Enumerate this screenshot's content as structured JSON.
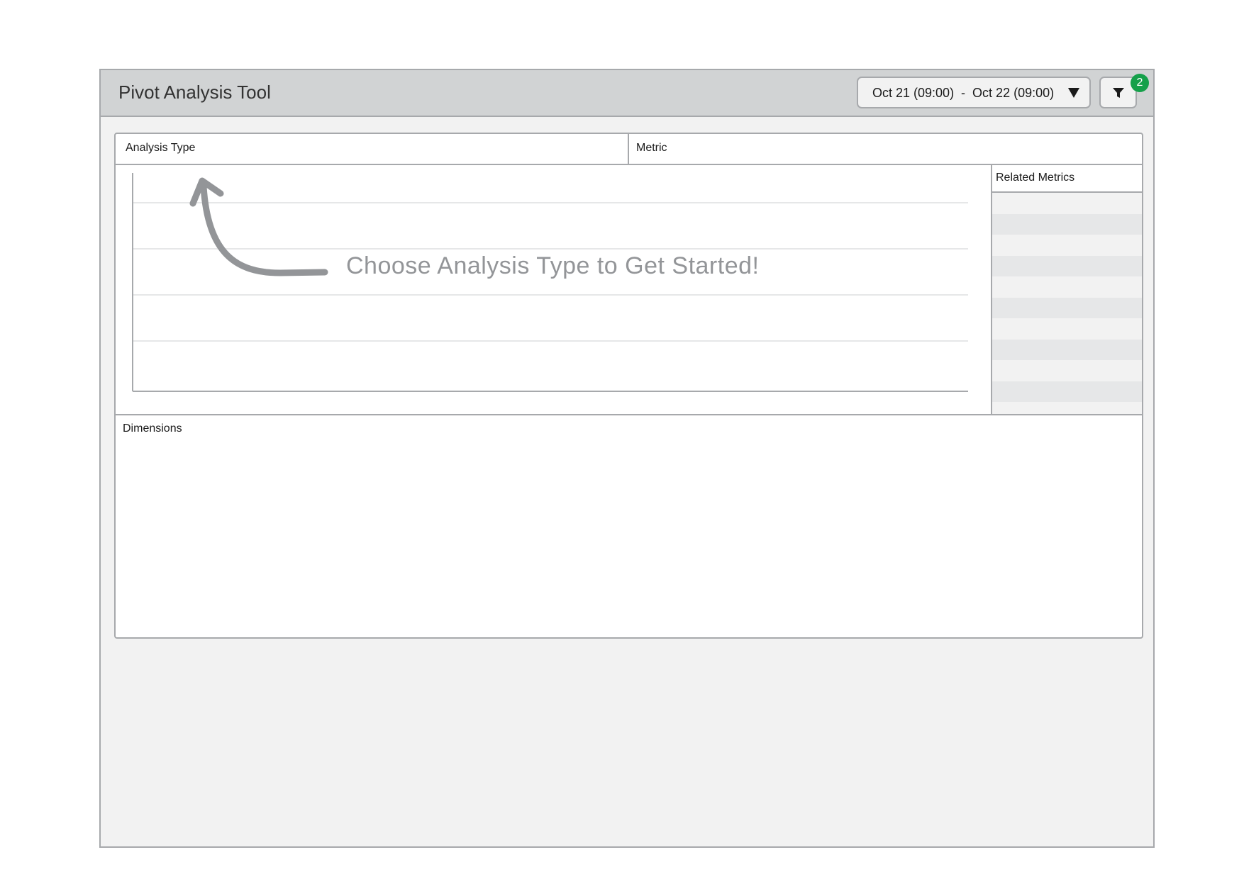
{
  "app": {
    "title": "Pivot Analysis Tool"
  },
  "header": {
    "date_range": "Oct 21 (09:00)  -  Oct 22 (09:00)",
    "date_range_icon": "chevron-down-icon",
    "filter_icon": "filter-icon",
    "filter_badge_count": "2",
    "filter_badge_color": "#15a04a"
  },
  "selectors": {
    "analysis_type_label": "Analysis Type",
    "metric_label": "Metric"
  },
  "chart": {
    "empty_message": "Choose Analysis Type to Get Started!",
    "pointer_icon": "curved-arrow-up-icon"
  },
  "related_metrics": {
    "label": "Related Metrics",
    "row_count": 11
  },
  "dimensions": {
    "label": "Dimensions"
  },
  "colors": {
    "header_bg": "#d1d3d4",
    "window_bg": "#f2f2f2",
    "border": "#a7a9ac",
    "muted_text": "#939598"
  }
}
